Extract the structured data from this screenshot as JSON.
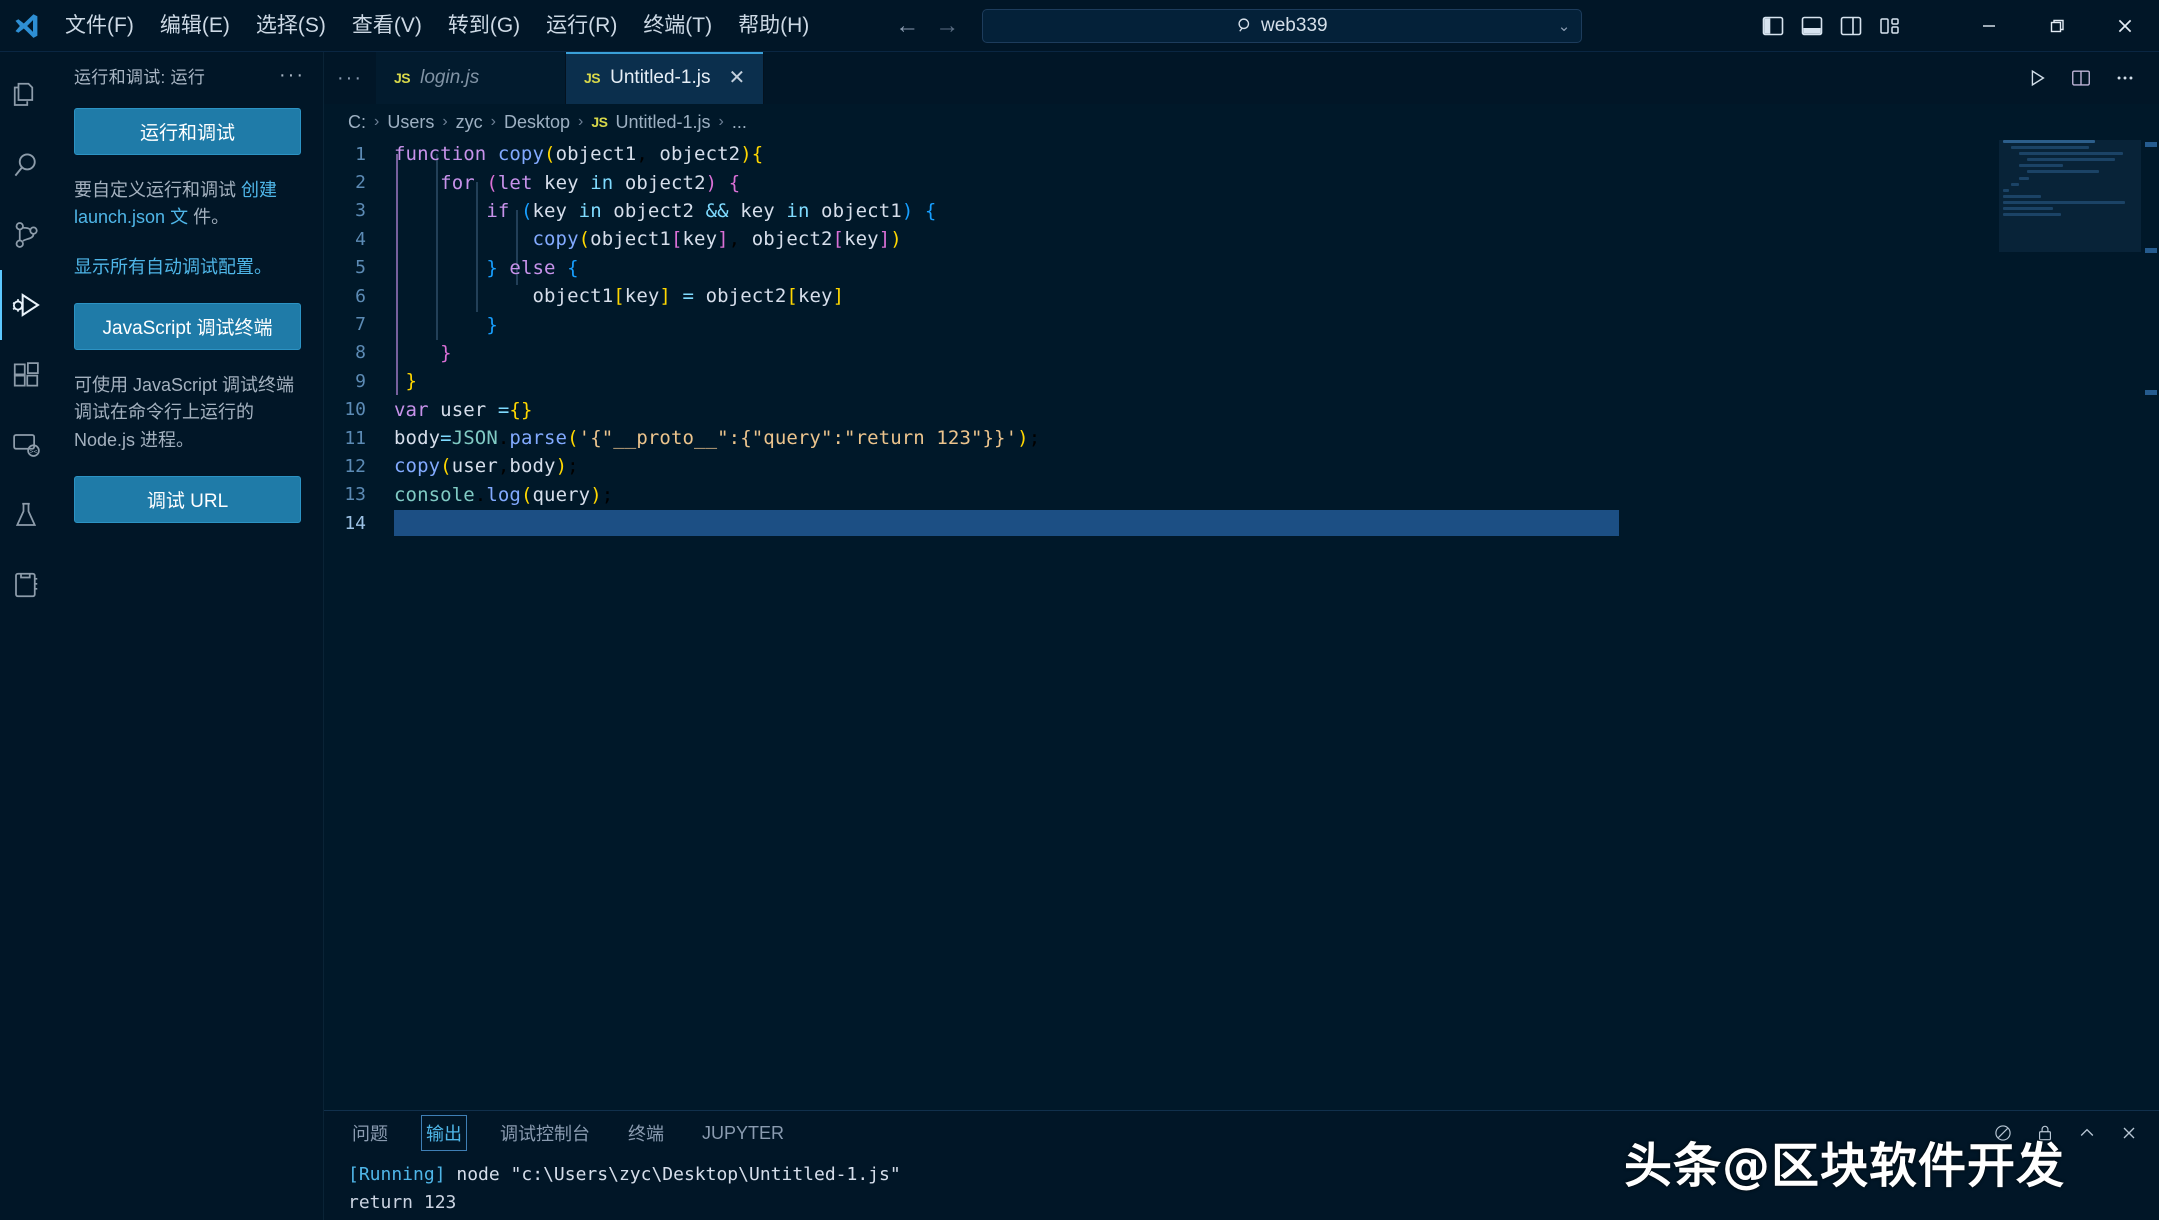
{
  "titlebar": {
    "logo_icon": "vscode-logo-icon",
    "menus": [
      {
        "label": "文件(F)",
        "name": "menu-file"
      },
      {
        "label": "编辑(E)",
        "name": "menu-edit"
      },
      {
        "label": "选择(S)",
        "name": "menu-selection"
      },
      {
        "label": "查看(V)",
        "name": "menu-view"
      },
      {
        "label": "转到(G)",
        "name": "menu-go"
      },
      {
        "label": "运行(R)",
        "name": "menu-run"
      },
      {
        "label": "终端(T)",
        "name": "menu-terminal"
      },
      {
        "label": "帮助(H)",
        "name": "menu-help"
      }
    ],
    "nav": {
      "back": "←",
      "forward": "→"
    },
    "search": {
      "value": "web339",
      "icon": "search-icon",
      "chevron": "⌄"
    },
    "layout_icons": [
      "toggle-primary-sidebar-icon",
      "toggle-panel-icon",
      "toggle-secondary-sidebar-icon",
      "customize-layout-icon"
    ],
    "window_controls": {
      "minimize": "—",
      "maximize": "❐",
      "close": "✕"
    }
  },
  "activitybar": {
    "items": [
      {
        "name": "activity-explorer",
        "icon": "files-icon",
        "active": false
      },
      {
        "name": "activity-search",
        "icon": "search-icon",
        "active": false
      },
      {
        "name": "activity-source-control",
        "icon": "source-control-icon",
        "active": false
      },
      {
        "name": "activity-run-debug",
        "icon": "run-and-debug-icon",
        "active": true
      },
      {
        "name": "activity-extensions",
        "icon": "extensions-icon",
        "active": false
      },
      {
        "name": "activity-remote",
        "icon": "remote-explorer-icon",
        "active": false
      },
      {
        "name": "activity-testing",
        "icon": "beaker-icon",
        "active": false
      },
      {
        "name": "activity-notebook",
        "icon": "notebook-icon",
        "active": false
      }
    ]
  },
  "sidebar": {
    "title": "运行和调试: 运行",
    "more_actions": "···",
    "run_debug_button": "运行和调试",
    "help_text_1_prefix": "要自定义运行和调试",
    "help_text_1_link": "创建 launch.json 文",
    "help_text_1_suffix": "件。",
    "help_text_2": "显示所有自动调试配置。",
    "js_debug_terminal_button": "JavaScript 调试终端",
    "help_text_3": "可使用 JavaScript 调试终端调试在命令行上运行的 Node.js 进程。",
    "debug_url_button": "调试 URL"
  },
  "editor": {
    "tabs": [
      {
        "name": "tab-login-js",
        "label": "login.js",
        "badge": "JS",
        "active": false,
        "italic": true
      },
      {
        "name": "tab-untitled-1-js",
        "label": "Untitled-1.js",
        "badge": "JS",
        "active": true,
        "close": "✕"
      }
    ],
    "actions": [
      {
        "name": "run-code-button",
        "icon": "play-icon"
      },
      {
        "name": "split-editor-button",
        "icon": "split-editor-icon"
      },
      {
        "name": "editor-more-actions",
        "icon": "ellipsis-icon"
      }
    ],
    "breadcrumb": [
      "C:",
      "Users",
      "zyc",
      "Desktop",
      "Untitled-1.js",
      "..."
    ],
    "breadcrumb_badge": "JS",
    "breadcrumb_separator": "›",
    "cursor_line": 14,
    "lines": [
      {
        "n": 1,
        "text": "function copy(object1, object2){"
      },
      {
        "n": 2,
        "text": "    for (let key in object2) {"
      },
      {
        "n": 3,
        "text": "        if (key in object2 && key in object1) {"
      },
      {
        "n": 4,
        "text": "            copy(object1[key], object2[key])"
      },
      {
        "n": 5,
        "text": "        } else {"
      },
      {
        "n": 6,
        "text": "            object1[key] = object2[key]"
      },
      {
        "n": 7,
        "text": "        }"
      },
      {
        "n": 8,
        "text": "    }"
      },
      {
        "n": 9,
        "text": "}"
      },
      {
        "n": 10,
        "text": "var user ={}"
      },
      {
        "n": 11,
        "text": "body=JSON.parse('{\"__proto__\":{\"query\":\"return 123\"}}');"
      },
      {
        "n": 12,
        "text": "copy(user,body);"
      },
      {
        "n": 13,
        "text": "console.log(query);"
      },
      {
        "n": 14,
        "text": ""
      }
    ]
  },
  "panel": {
    "tabs": [
      {
        "name": "panel-tab-problems",
        "label": "问题",
        "active": false
      },
      {
        "name": "panel-tab-output",
        "label": "输出",
        "active": true
      },
      {
        "name": "panel-tab-debug-console",
        "label": "调试控制台",
        "active": false
      },
      {
        "name": "panel-tab-terminal",
        "label": "终端",
        "active": false
      },
      {
        "name": "panel-tab-jupyter",
        "label": "JUPYTER",
        "active": false
      }
    ],
    "output_lines": [
      {
        "prefix": "[Running]",
        "text": " node \"c:\\Users\\zyc\\Desktop\\Untitled-1.js\""
      },
      {
        "prefix": "",
        "text": "return 123"
      }
    ],
    "actions": [
      {
        "name": "clear-output-button",
        "icon": "clear-icon"
      },
      {
        "name": "lock-panel-button",
        "icon": "lock-icon"
      },
      {
        "name": "maximize-panel-button",
        "icon": "chevron-up-icon"
      },
      {
        "name": "close-panel-button",
        "icon": "close-icon"
      }
    ]
  },
  "watermark": {
    "text": "头条@区块软件开发"
  },
  "colors": {
    "titlebar_bg": "#011627",
    "editor_bg": "#001829",
    "accent": "#1f7ba8",
    "active_tab_bg": "#0b2f4d",
    "link": "#4fb6e8",
    "selection": "#1c4f84"
  }
}
